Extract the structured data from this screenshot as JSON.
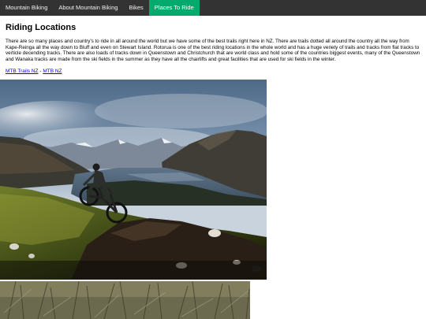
{
  "nav": {
    "items": [
      {
        "label": "Mountain Biking",
        "active": false
      },
      {
        "label": "About Mountain Biking",
        "active": false
      },
      {
        "label": "Bikes",
        "active": false
      },
      {
        "label": "Places To Ride",
        "active": true
      }
    ]
  },
  "page": {
    "title": "Riding Locations",
    "intro": "There are so many places and country's to ride in all around the world but we have some of the best trails right here in NZ. There are trails dotted all around the country all the way from Kape-Reinga all the way down to Bluff and even on Stewart Island. Rotorua is one of the best riding locations in the whole world and has a huge veriety of trails and tracks from flat tracks to verticle decending tracks. There are also loads of tracks down in Queenstown and Christchurch that are world class and hold some of the countries biggest events, many of the Queenstown and Wanaka tracks are made from the ski fields in the summer as they have all the chairlifts and great facilities that are used for ski fields in the winter.",
    "links": [
      {
        "label": "MTB Trails NZ"
      },
      {
        "label": "MTB NZ"
      }
    ],
    "separator": " - "
  },
  "colors": {
    "nav_bg": "#333333",
    "nav_active": "#04AA6D",
    "link": "#0000EE"
  }
}
